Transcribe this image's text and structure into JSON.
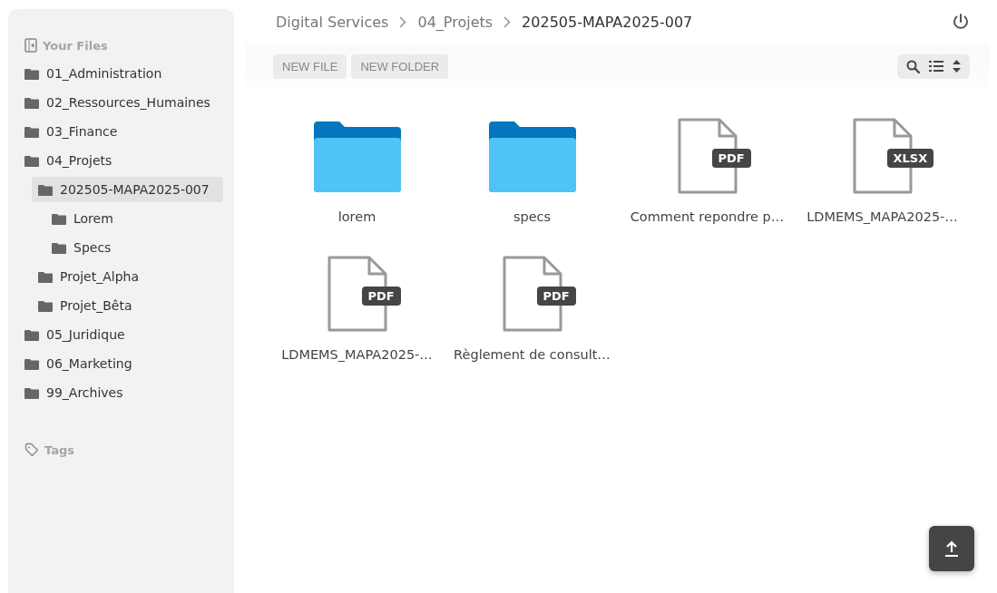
{
  "sidebar": {
    "title": "Your Files",
    "tree": [
      {
        "label": "01_Administration",
        "selected": false
      },
      {
        "label": "02_Ressources_Humaines",
        "selected": false
      },
      {
        "label": "03_Finance",
        "selected": false
      },
      {
        "label": "04_Projets",
        "selected": false,
        "children": [
          {
            "label": "202505-MAPA2025-007",
            "selected": true,
            "children": [
              {
                "label": "Lorem",
                "selected": false
              },
              {
                "label": "Specs",
                "selected": false
              }
            ]
          },
          {
            "label": "Projet_Alpha",
            "selected": false
          },
          {
            "label": "Projet_Bêta",
            "selected": false
          }
        ]
      },
      {
        "label": "05_Juridique",
        "selected": false
      },
      {
        "label": "06_Marketing",
        "selected": false
      },
      {
        "label": "99_Archives",
        "selected": false
      }
    ],
    "tags_title": "Tags"
  },
  "breadcrumb": [
    "Digital Services",
    "04_Projets",
    "202505-MAPA2025-007"
  ],
  "toolbar": {
    "buttons": [
      "NEW FILE",
      "NEW FOLDER"
    ]
  },
  "files": [
    {
      "kind": "folder",
      "name": "lorem"
    },
    {
      "kind": "folder",
      "name": "specs"
    },
    {
      "kind": "file",
      "name": "Comment repondre p…",
      "badge": "PDF"
    },
    {
      "kind": "file",
      "name": "LDMEMS_MAPA2025-…",
      "badge": "XLSX"
    },
    {
      "kind": "file",
      "name": "LDMEMS_MAPA2025-…",
      "badge": "PDF"
    },
    {
      "kind": "file",
      "name": "Règlement de consult…",
      "badge": "PDF"
    }
  ]
}
